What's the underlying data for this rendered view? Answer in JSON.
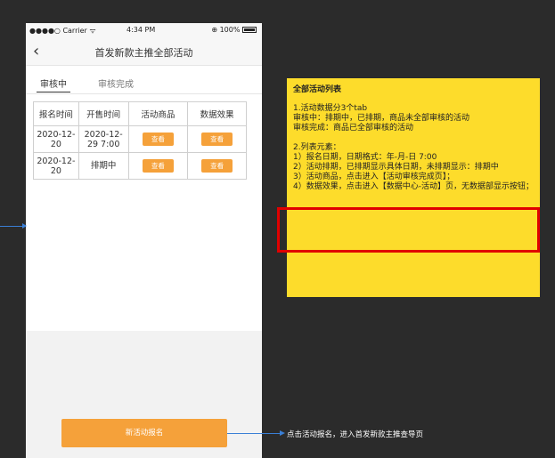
{
  "status_bar": {
    "carrier": "●●●●○ Carrier ᯤ",
    "time": "4:34 PM",
    "battery": "⊕ 100%"
  },
  "nav": {
    "back_icon": "chevron-left-icon",
    "back_glyph": "‹",
    "title": "首发新款主推全部活动"
  },
  "tabs": [
    {
      "label": "审核中",
      "active": true
    },
    {
      "label": "审核完成",
      "active": false
    }
  ],
  "table": {
    "headers": [
      "报名时间",
      "开售时间",
      "活动商品",
      "数据效果"
    ],
    "rows": [
      {
        "signup": "2020-12-20",
        "sale_start": "2020-12-29 7:00",
        "goods_btn": "查看",
        "data_btn": "查看"
      },
      {
        "signup": "2020-12-20",
        "sale_start": "排期中",
        "goods_btn": "查看",
        "data_btn": "查看"
      }
    ]
  },
  "cta": {
    "label": "新活动报名"
  },
  "annotation_right": "点击活动报名，进入首发新款主推查导页",
  "note": {
    "title": "全部活动列表",
    "lines_1": [
      "1.活动数据分3个tab",
      "审核中：排期中，已排期，商品未全部审核的活动",
      "审核完成：商品已全部审核的活动"
    ],
    "lines_2": [
      "2.列表元素：",
      "1）报名日期，日期格式：年-月-日 7:00",
      "2）活动排期，已排期显示具体日期，未排期显示：排期中",
      "3）活动商品，点击进入【活动审核完成页】；",
      "4）数据效果，点击进入【数据中心-活动】页，无数据部显示按钮；"
    ]
  },
  "colors": {
    "accent_orange": "#f5a13a",
    "note_yellow": "#fddc2b",
    "highlight_red": "#e00000",
    "connector_blue": "#3a7fd6"
  }
}
